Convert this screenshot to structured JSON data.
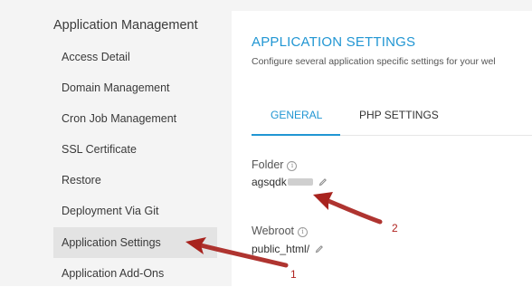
{
  "sidebar": {
    "title": "Application Management",
    "items": [
      {
        "label": "Access Detail"
      },
      {
        "label": "Domain Management"
      },
      {
        "label": "Cron Job Management"
      },
      {
        "label": "SSL Certificate"
      },
      {
        "label": "Restore"
      },
      {
        "label": "Deployment Via Git"
      },
      {
        "label": "Application Settings",
        "active": true
      },
      {
        "label": "Application Add-Ons"
      }
    ]
  },
  "main": {
    "title": "APPLICATION SETTINGS",
    "subtitle": "Configure several application specific settings for your wel",
    "tabs": [
      {
        "label": "GENERAL",
        "active": true
      },
      {
        "label": "PHP SETTINGS",
        "active": false
      }
    ],
    "fields": {
      "folder": {
        "label": "Folder",
        "value": "agsqdk"
      },
      "webroot": {
        "label": "Webroot",
        "value": "public_html/"
      }
    }
  },
  "annotations": {
    "arrow1_number": "1",
    "arrow2_number": "2",
    "arrow_color": "#a8231e"
  },
  "colors": {
    "accent": "#2196d3",
    "sidebar_bg": "#f4f4f4",
    "active_item_bg": "#e3e3e3"
  }
}
